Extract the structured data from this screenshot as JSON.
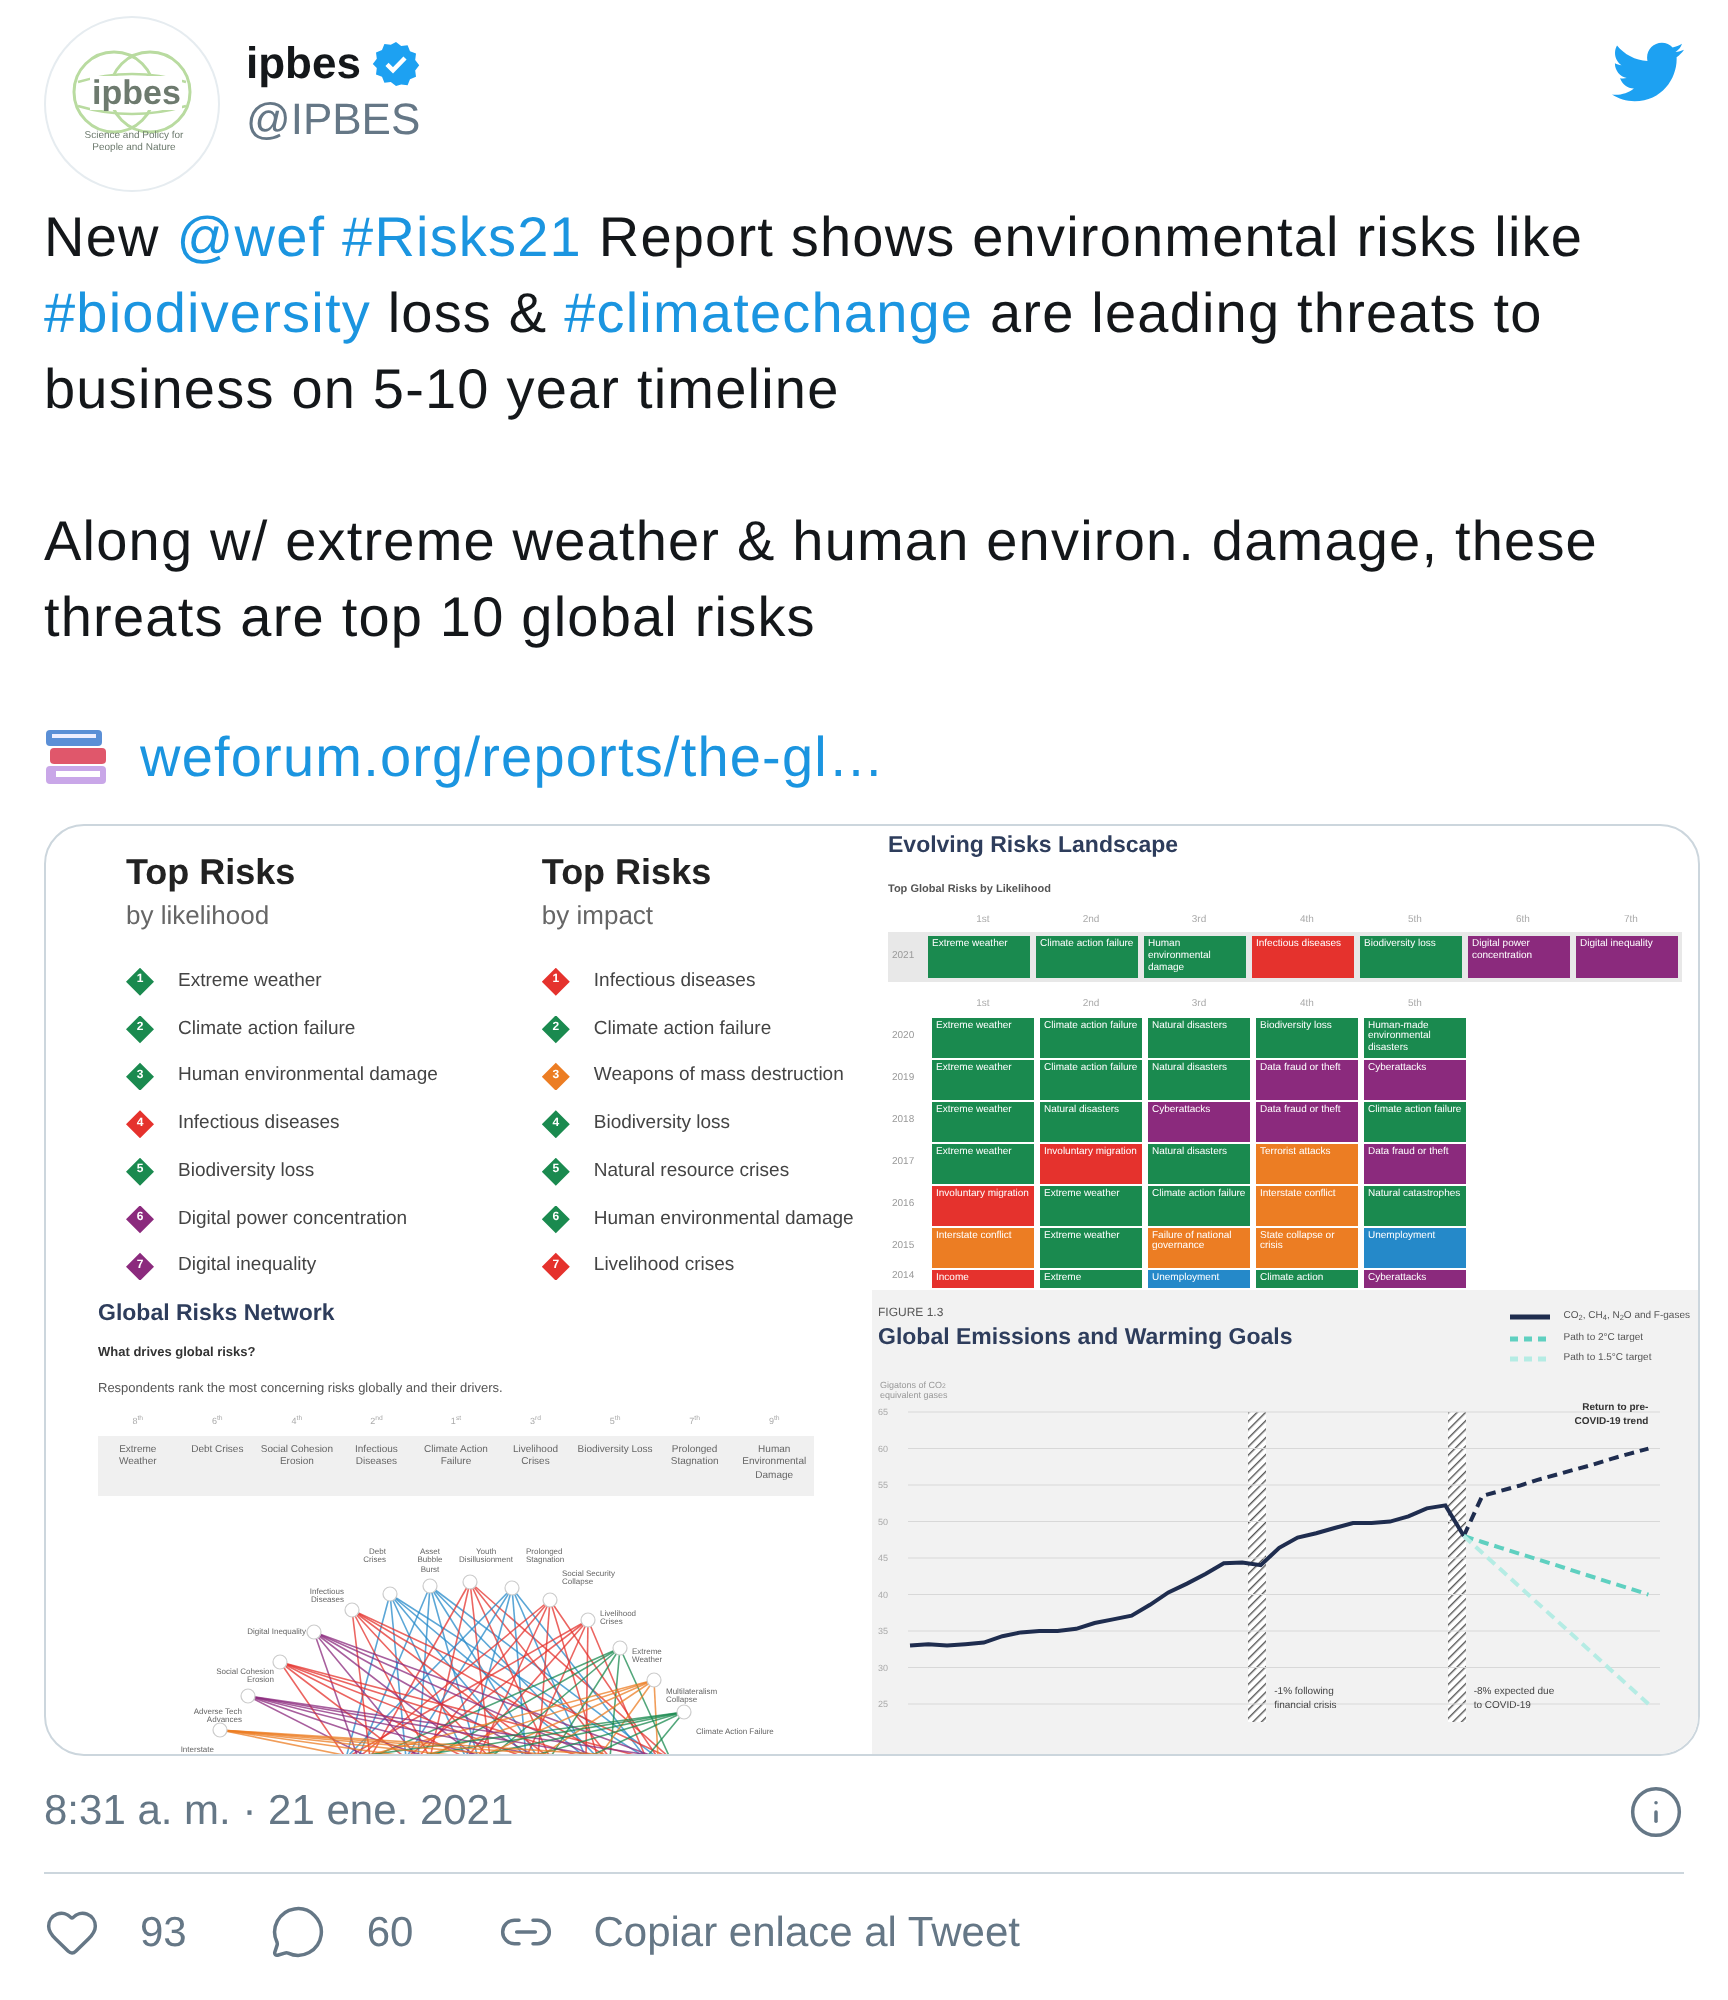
{
  "author": {
    "logo_text": "ipbes",
    "logo_tagline": "Science and Policy for People and Nature",
    "name": "ipbes",
    "verified": true,
    "handle": "@IPBES"
  },
  "tweet": {
    "paragraphs": [
      [
        {
          "kind": "text",
          "text": "New"
        },
        {
          "kind": "link",
          "text": "@wef"
        },
        {
          "kind": "link",
          "text": "#Risks21"
        },
        {
          "kind": "text",
          "text": "Report shows environmental risks like"
        },
        {
          "kind": "link",
          "text": "#biodiversity"
        },
        {
          "kind": "text",
          "text": "loss &"
        },
        {
          "kind": "link",
          "text": "#climatechange"
        },
        {
          "kind": "text",
          "text": "are leading threats to business on 5-10 year timeline"
        }
      ],
      [
        {
          "kind": "text",
          "text": "Along w/ extreme weather & human environ. damage, these threats are top 10 global risks"
        }
      ]
    ],
    "link": "weforum.org/reports/the-gl…"
  },
  "attachment": {
    "top_risks": [
      {
        "title": "Top Risks",
        "subtitle": "by likelihood",
        "items": [
          {
            "number": "1",
            "label": "Extreme weather",
            "color": "#1a8a4f"
          },
          {
            "number": "2",
            "label": "Climate action failure",
            "color": "#1a8a4f"
          },
          {
            "number": "3",
            "label": "Human environmental damage",
            "color": "#1a8a4f"
          },
          {
            "number": "4",
            "label": "Infectious diseases",
            "color": "#e5322d"
          },
          {
            "number": "5",
            "label": "Biodiversity loss",
            "color": "#1a8a4f"
          },
          {
            "number": "6",
            "label": "Digital power concentration",
            "color": "#8b2a7d"
          },
          {
            "number": "7",
            "label": "Digital inequality",
            "color": "#8b2a7d"
          }
        ]
      },
      {
        "title": "Top Risks",
        "subtitle": "by impact",
        "items": [
          {
            "number": "1",
            "label": "Infectious diseases",
            "color": "#e5322d"
          },
          {
            "number": "2",
            "label": "Climate action failure",
            "color": "#1a8a4f"
          },
          {
            "number": "3",
            "label": "Weapons of mass destruction",
            "color": "#ec7d23"
          },
          {
            "number": "4",
            "label": "Biodiversity loss",
            "color": "#1a8a4f"
          },
          {
            "number": "5",
            "label": "Natural resource crises",
            "color": "#1a8a4f"
          },
          {
            "number": "6",
            "label": "Human environmental damage",
            "color": "#1a8a4f"
          },
          {
            "number": "7",
            "label": "Livelihood crises",
            "color": "#e5322d"
          }
        ]
      }
    ],
    "network": {
      "title": "Global Risks Network",
      "question": "What drives global risks?",
      "description": "Respondents rank the most concerning risks globally and their drivers.",
      "ranks": [
        {
          "rank": "8$^{th}$",
          "label": "Extreme Weather"
        },
        {
          "rank": "6$^{th}$",
          "label": "Debt Crises"
        },
        {
          "rank": "4$^{th}$",
          "label": "Social Cohesion Erosion"
        },
        {
          "rank": "2$^{nd}$",
          "label": "Infectious Diseases"
        },
        {
          "rank": "1$^{st}$",
          "label": "Climate Action Failure"
        },
        {
          "rank": "3$^{rd}$",
          "label": "Livelihood Crises"
        },
        {
          "rank": "5$^{th}$",
          "label": "Biodiversity Loss"
        },
        {
          "rank": "7$^{th}$",
          "label": "Prolonged Stagnation"
        },
        {
          "rank": "9$^{th}$",
          "label": "Human Environmental Damage"
        }
      ],
      "nodes": [
        {
          "label": "Debt Crises"
        },
        {
          "label": "Asset Bubble Burst"
        },
        {
          "label": "Youth Disillusionment"
        },
        {
          "label": "Prolonged Stagnation"
        },
        {
          "label": "Social Security Collapse"
        },
        {
          "label": "Infectious Diseases"
        },
        {
          "label": "Livelihood Crises"
        },
        {
          "label": "Digital Inequality"
        },
        {
          "label": "Extreme Weather"
        },
        {
          "label": "Social Cohesion Erosion"
        },
        {
          "label": "Multilateralism Collapse"
        },
        {
          "label": "Adverse Tech Advances"
        },
        {
          "label": "Climate Action Failure"
        },
        {
          "label": "Interstate"
        }
      ]
    },
    "landscape": {
      "title": "Evolving Risks Landscape",
      "subtitle": "Top Global Risks by Likelihood",
      "top_ranks": [
        "1st",
        "2nd",
        "3rd",
        "4th",
        "5th",
        "6th",
        "7th"
      ],
      "top_row": {
        "year": "2021",
        "cells": [
          {
            "label": "Extreme weather",
            "color": "#1a8a4f"
          },
          {
            "label": "Climate action failure",
            "color": "#1a8a4f"
          },
          {
            "label": "Human environmental damage",
            "color": "#1a8a4f"
          },
          {
            "label": "Infectious diseases",
            "color": "#e5322d"
          },
          {
            "label": "Biodiversity loss",
            "color": "#1a8a4f"
          },
          {
            "label": "Digital power concentration",
            "color": "#8b2a7d"
          },
          {
            "label": "Digital inequality",
            "color": "#8b2a7d"
          }
        ]
      },
      "ranks": [
        "1st",
        "2nd",
        "3rd",
        "4th",
        "5th"
      ],
      "rows": [
        {
          "year": "2020",
          "cells": [
            {
              "label": "Extreme weather",
              "color": "#1a8a4f"
            },
            {
              "label": "Climate action failure",
              "color": "#1a8a4f"
            },
            {
              "label": "Natural disasters",
              "color": "#1a8a4f"
            },
            {
              "label": "Biodiversity loss",
              "color": "#1a8a4f"
            },
            {
              "label": "Human-made environmental disasters",
              "color": "#1a8a4f"
            }
          ]
        },
        {
          "year": "2019",
          "cells": [
            {
              "label": "Extreme weather",
              "color": "#1a8a4f"
            },
            {
              "label": "Climate action failure",
              "color": "#1a8a4f"
            },
            {
              "label": "Natural disasters",
              "color": "#1a8a4f"
            },
            {
              "label": "Data fraud or theft",
              "color": "#8b2a7d"
            },
            {
              "label": "Cyberattacks",
              "color": "#8b2a7d"
            }
          ]
        },
        {
          "year": "2018",
          "cells": [
            {
              "label": "Extreme weather",
              "color": "#1a8a4f"
            },
            {
              "label": "Natural disasters",
              "color": "#1a8a4f"
            },
            {
              "label": "Cyberattacks",
              "color": "#8b2a7d"
            },
            {
              "label": "Data fraud or theft",
              "color": "#8b2a7d"
            },
            {
              "label": "Climate action failure",
              "color": "#1a8a4f"
            }
          ]
        },
        {
          "year": "2017",
          "cells": [
            {
              "label": "Extreme weather",
              "color": "#1a8a4f"
            },
            {
              "label": "Involuntary migration",
              "color": "#e5322d"
            },
            {
              "label": "Natural disasters",
              "color": "#1a8a4f"
            },
            {
              "label": "Terrorist attacks",
              "color": "#ec7d23"
            },
            {
              "label": "Data fraud or theft",
              "color": "#8b2a7d"
            }
          ]
        },
        {
          "year": "2016",
          "cells": [
            {
              "label": "Involuntary migration",
              "color": "#e5322d"
            },
            {
              "label": "Extreme weather",
              "color": "#1a8a4f"
            },
            {
              "label": "Climate action failure",
              "color": "#1a8a4f"
            },
            {
              "label": "Interstate conflict",
              "color": "#ec7d23"
            },
            {
              "label": "Natural catastrophes",
              "color": "#1a8a4f"
            }
          ]
        },
        {
          "year": "2015",
          "cells": [
            {
              "label": "Interstate conflict",
              "color": "#ec7d23"
            },
            {
              "label": "Extreme weather",
              "color": "#1a8a4f"
            },
            {
              "label": "Failure of national governance",
              "color": "#ec7d23"
            },
            {
              "label": "State collapse or crisis",
              "color": "#ec7d23"
            },
            {
              "label": "Unemployment",
              "color": "#2589c9"
            }
          ]
        },
        {
          "year": "2014",
          "cells": [
            {
              "label": "Income",
              "color": "#e5322d"
            },
            {
              "label": "Extreme",
              "color": "#1a8a4f"
            },
            {
              "label": "Unemployment",
              "color": "#2589c9"
            },
            {
              "label": "Climate action",
              "color": "#1a8a4f"
            },
            {
              "label": "Cyberattacks",
              "color": "#8b2a7d"
            }
          ]
        }
      ]
    },
    "emissions": {
      "figure": "FIGURE 1.3",
      "title": "Global Emissions and Warming Goals",
      "chart_data": {
        "type": "line",
        "ylabel": "Gigatons of CO$_{2}$ equivalent gases",
        "grid": true,
        "ylim": [
          25,
          65
        ],
        "yticks": [
          25,
          30,
          35,
          40,
          45,
          50,
          55,
          60,
          65
        ],
        "series": [
          {
            "name": "CO$_{2}$, CH$_{4}$, N$_{2}$O and F-gases",
            "color": "#1f2d4f",
            "line_style": "solid",
            "values": [
              33,
              33.2,
              33,
              33.2,
              33.4,
              34.3,
              34.8,
              35,
              35,
              35.3,
              36.1,
              36.6,
              37.1,
              38.6,
              40.3,
              41.5,
              42.8,
              44.3,
              44.4,
              44,
              46.4,
              47.8,
              48.4,
              49.1,
              49.8,
              49.8,
              50,
              50.7,
              51.8,
              52.2,
              48,
              null,
              null,
              null,
              null,
              null,
              null,
              null,
              null,
              null,
              null
            ]
          },
          {
            "name": "Return to pre-COVID-19 trend",
            "color": "#1f2d4f",
            "line_style": "dashed",
            "values": [
              null,
              null,
              null,
              null,
              null,
              null,
              null,
              null,
              null,
              null,
              null,
              null,
              null,
              null,
              null,
              null,
              null,
              null,
              null,
              null,
              null,
              null,
              null,
              null,
              null,
              null,
              null,
              null,
              null,
              null,
              48,
              53.5,
              54.2,
              54.9,
              55.7,
              56.4,
              57.1,
              57.8,
              58.6,
              59.3,
              60
            ]
          },
          {
            "name": "Path to 2°C target",
            "color": "#5fd0c0",
            "line_style": "dashed",
            "values": [
              null,
              null,
              null,
              null,
              null,
              null,
              null,
              null,
              null,
              null,
              null,
              null,
              null,
              null,
              null,
              null,
              null,
              null,
              null,
              null,
              null,
              null,
              null,
              null,
              null,
              null,
              null,
              null,
              null,
              null,
              48,
              47.2,
              46.4,
              45.6,
              44.8,
              44,
              43.2,
              42.4,
              41.6,
              40.8,
              40
            ]
          },
          {
            "name": "Path to 1.5°C target",
            "color": "#b5ece4",
            "line_style": "dashed",
            "values": [
              null,
              null,
              null,
              null,
              null,
              null,
              null,
              null,
              null,
              null,
              null,
              null,
              null,
              null,
              null,
              null,
              null,
              null,
              null,
              null,
              null,
              null,
              null,
              null,
              null,
              null,
              null,
              null,
              null,
              null,
              48,
              45.7,
              43.4,
              41.1,
              38.8,
              36.5,
              34.2,
              31.9,
              29.6,
              27.3,
              25
            ]
          }
        ],
        "annotations": [
          "-1% following financial crisis",
          "-8% expected due to COVID-19"
        ]
      }
    }
  },
  "timestamp": "8:31 a. m. · 21 ene. 2021",
  "actions": [
    {
      "kind": "like",
      "text": "93"
    },
    {
      "kind": "reply",
      "text": "60"
    },
    {
      "kind": "copy_link",
      "text": "Copiar enlace al Tweet"
    }
  ]
}
